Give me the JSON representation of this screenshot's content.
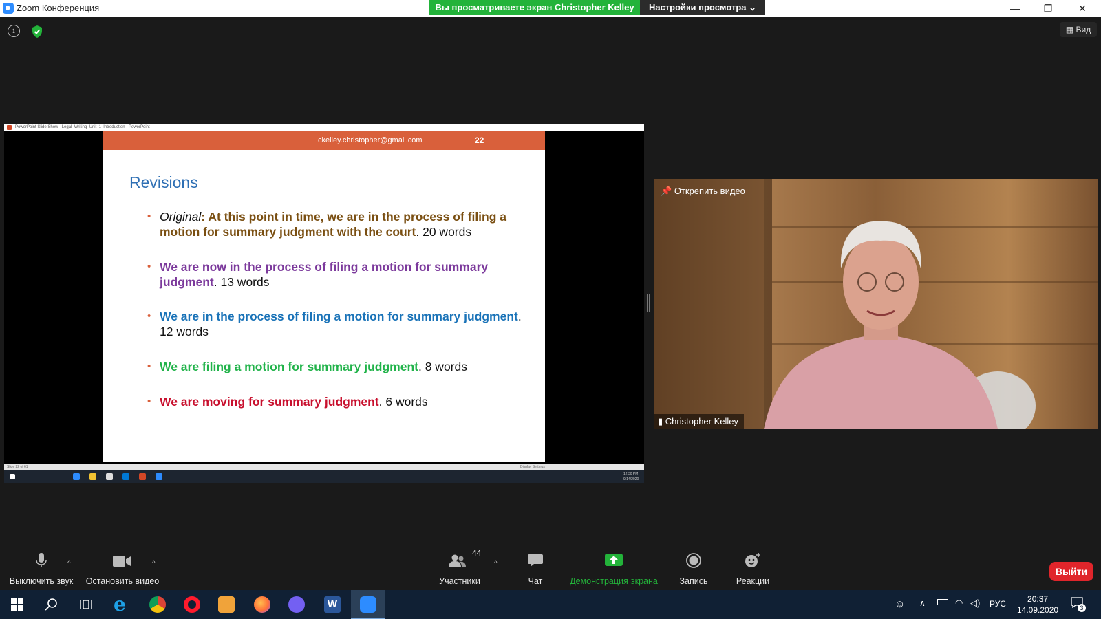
{
  "window": {
    "title": "Zoom Конференция",
    "share_banner": "Вы просматриваете экран Christopher Kelley",
    "view_settings": "Настройки просмотра",
    "view_button": "Вид"
  },
  "presentation": {
    "window_title": "PowerPoint Slide Show - Legal_Writing_Unit_1_Introduction - PowerPoint",
    "header_email": "ckelley.christopher@gmail.com",
    "slide_number": "22",
    "title": "Revisions",
    "bullets": [
      {
        "prefix": "Original",
        "bold_text": ": At this point in time, we are in the process of filing a motion for summary judgment with the court",
        "count": ".  20 words"
      },
      {
        "bold_text": "We are now in the process of filing a motion for summary judgment",
        "count": ".  13 words"
      },
      {
        "bold_text": "We are in the process of filing a motion for summary judgment",
        "count": ".  12 words"
      },
      {
        "bold_text": "We are filing a motion for summary judgment",
        "count": ".  8 words"
      },
      {
        "bold_text": "We are moving for summary judgment",
        "count": ".  6 words"
      }
    ],
    "status_left": "Slide 22 of 61",
    "status_right": "Display Settings",
    "inner_time": "12:30 PM",
    "inner_date": "9/14/2020"
  },
  "video": {
    "unpin_label": "Открепить видео",
    "participant_name": "Christopher Kelley"
  },
  "controls": {
    "mute": "Выключить звук",
    "stop_video": "Остановить видео",
    "participants": "Участники",
    "participants_count": "44",
    "chat": "Чат",
    "share": "Демонстрация экрана",
    "record": "Запись",
    "reactions": "Реакции",
    "leave": "Выйти"
  },
  "taskbar": {
    "language": "РУС",
    "time": "20:37",
    "date": "14.09.2020",
    "notifications": "3"
  },
  "colors": {
    "share_green": "#23b33a",
    "leave_red": "#e0252b",
    "slide_header": "#d9603b",
    "slide_title": "#2e6fb4"
  }
}
